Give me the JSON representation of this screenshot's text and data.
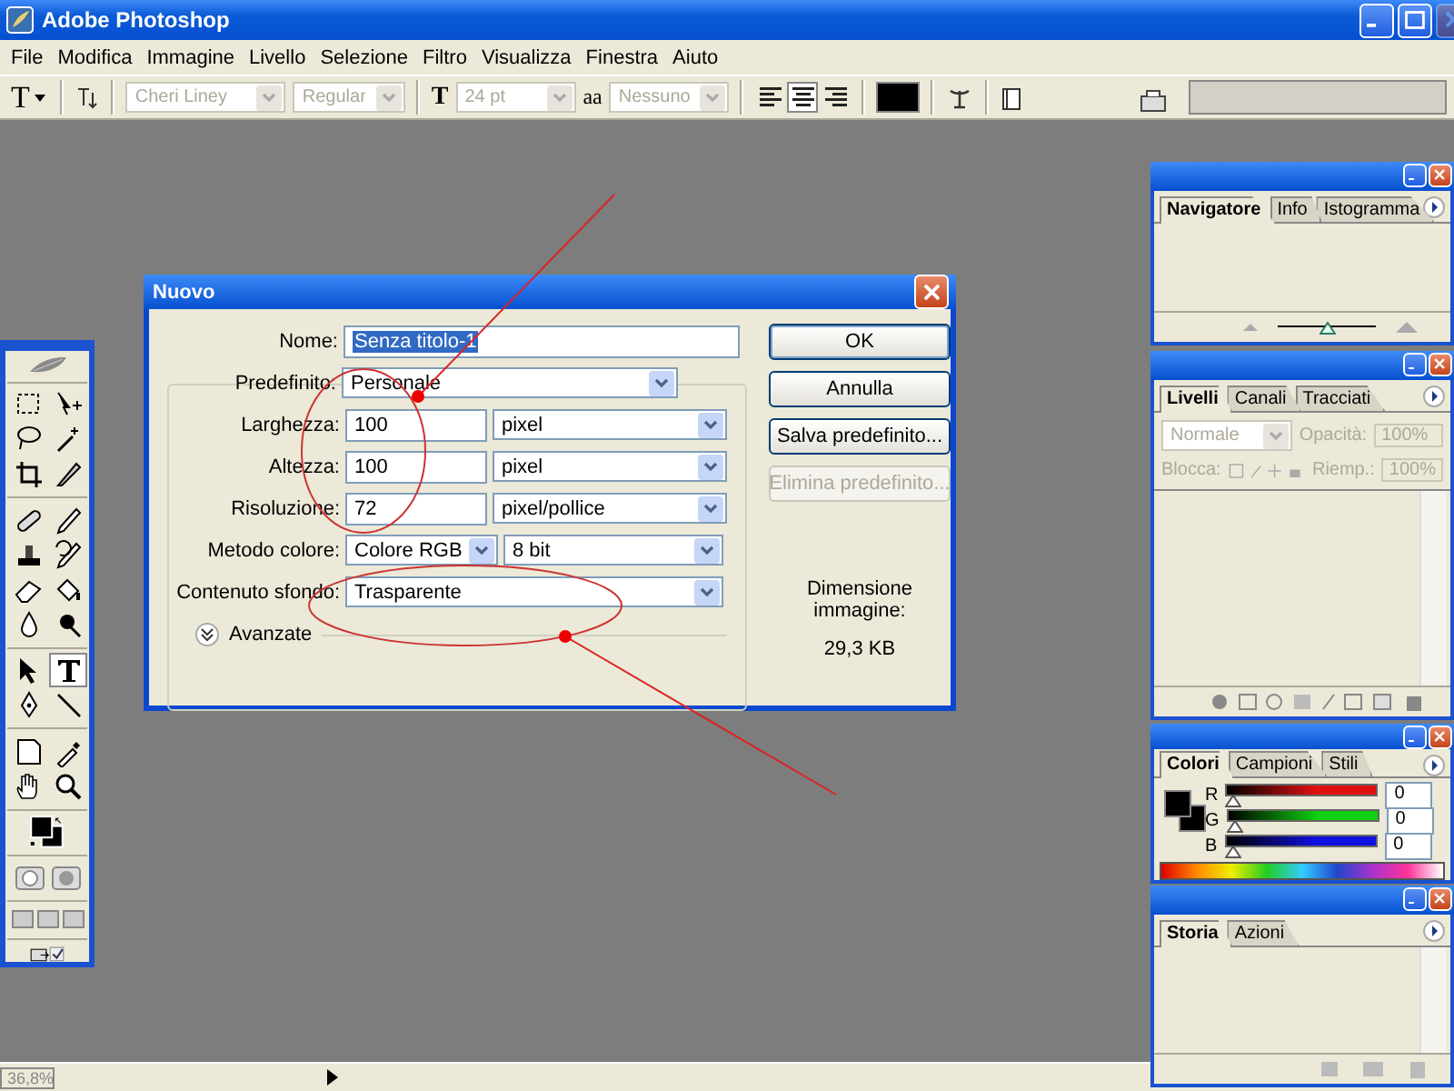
{
  "window": {
    "title": "Adobe Photoshop"
  },
  "menu": [
    "File",
    "Modifica",
    "Immagine",
    "Livello",
    "Selezione",
    "Filtro",
    "Visualizza",
    "Finestra",
    "Aiuto"
  ],
  "options_bar": {
    "tool_glyph": "T",
    "font_family": {
      "value": "Cheri Liney",
      "disabled": true
    },
    "font_style": {
      "value": "Regular",
      "disabled": true
    },
    "size_glyph": "T",
    "font_size": {
      "value": "24 pt",
      "disabled": true
    },
    "antialias_glyph": "aa",
    "antialias": {
      "value": "Nessuno",
      "disabled": true
    },
    "align": [
      {
        "kind": "left",
        "selected": false
      },
      {
        "kind": "center",
        "selected": true
      },
      {
        "kind": "right",
        "selected": false
      }
    ]
  },
  "toolbox": {
    "tools": [
      {
        "kind": "marquee",
        "selected": false
      },
      {
        "kind": "move",
        "selected": false
      },
      {
        "kind": "lasso",
        "selected": false
      },
      {
        "kind": "wand",
        "selected": false
      },
      {
        "kind": "crop",
        "selected": false
      },
      {
        "kind": "slice",
        "selected": false
      },
      {
        "kind": "heal",
        "selected": false
      },
      {
        "kind": "brush",
        "selected": false
      },
      {
        "kind": "stamp",
        "selected": false
      },
      {
        "kind": "history",
        "selected": false
      },
      {
        "kind": "eraser",
        "selected": false
      },
      {
        "kind": "bucket",
        "selected": false
      },
      {
        "kind": "blur",
        "selected": false
      },
      {
        "kind": "dodge",
        "selected": false
      },
      {
        "kind": "select",
        "selected": false
      },
      {
        "kind": "type",
        "selected": true
      },
      {
        "kind": "pen",
        "selected": false
      },
      {
        "kind": "line",
        "selected": false
      },
      {
        "kind": "notes",
        "selected": false
      },
      {
        "kind": "eyedropper",
        "selected": false
      },
      {
        "kind": "hand",
        "selected": false
      },
      {
        "kind": "zoom",
        "selected": false
      }
    ]
  },
  "dialog": {
    "title": "Nuovo",
    "name": {
      "label": "Nome:",
      "value": "Senza titolo-1"
    },
    "preset": {
      "label": "Predefinito:",
      "value": "Personale"
    },
    "size_rows": [
      {
        "label": "Larghezza:",
        "value": "100",
        "unit": "pixel"
      },
      {
        "label": "Altezza:",
        "value": "100",
        "unit": "pixel"
      },
      {
        "label": "Risoluzione:",
        "value": "72",
        "unit": "pixel/pollice"
      }
    ],
    "color_mode": {
      "label": "Metodo colore:",
      "value": "Colore RGB",
      "depth": "8 bit"
    },
    "background": {
      "label": "Contenuto sfondo:",
      "value": "Trasparente"
    },
    "advanced": {
      "label": "Avanzate",
      "expanded": false
    },
    "buttons": [
      {
        "label": "OK",
        "default": true,
        "disabled": false
      },
      {
        "label": "Annulla",
        "default": false,
        "disabled": false
      },
      {
        "label": "Salva predefinito...",
        "default": false,
        "disabled": false
      },
      {
        "label": "Elimina predefinito...",
        "default": false,
        "disabled": true
      }
    ],
    "size_label": "Dimensione immagine:",
    "size_value": "29,3 KB"
  },
  "panels": [
    {
      "kind": "navigator",
      "tabs": [
        {
          "label": "Navigatore",
          "selected": true
        },
        {
          "label": "Info",
          "selected": false
        },
        {
          "label": "Istogramma",
          "selected": false
        }
      ],
      "zoom": {
        "level": 0.5
      }
    },
    {
      "kind": "layers",
      "tabs": [
        {
          "label": "Livelli",
          "selected": true
        },
        {
          "label": "Canali",
          "selected": false
        },
        {
          "label": "Tracciati",
          "selected": false
        }
      ],
      "blend": "Normale",
      "opacity_label": "Opacità:",
      "opacity": "100%",
      "lock_label": "Blocca:",
      "fill_label": "Riemp.:",
      "fill": "100%"
    },
    {
      "kind": "colors",
      "tabs": [
        {
          "label": "Colori",
          "selected": true
        },
        {
          "label": "Campioni",
          "selected": false
        },
        {
          "label": "Stili",
          "selected": false
        }
      ],
      "channels": [
        {
          "label": "R",
          "value": "0",
          "level": 0,
          "color": "#e01010"
        },
        {
          "label": "G",
          "value": "0",
          "level": 0,
          "color": "#10d010"
        },
        {
          "label": "B",
          "value": "0",
          "level": 0,
          "color": "#1010e0"
        }
      ]
    },
    {
      "kind": "history",
      "tabs": [
        {
          "label": "Storia",
          "selected": true
        },
        {
          "label": "Azioni",
          "selected": false
        }
      ]
    }
  ],
  "status_bar": {
    "zoom": "36,8%"
  }
}
